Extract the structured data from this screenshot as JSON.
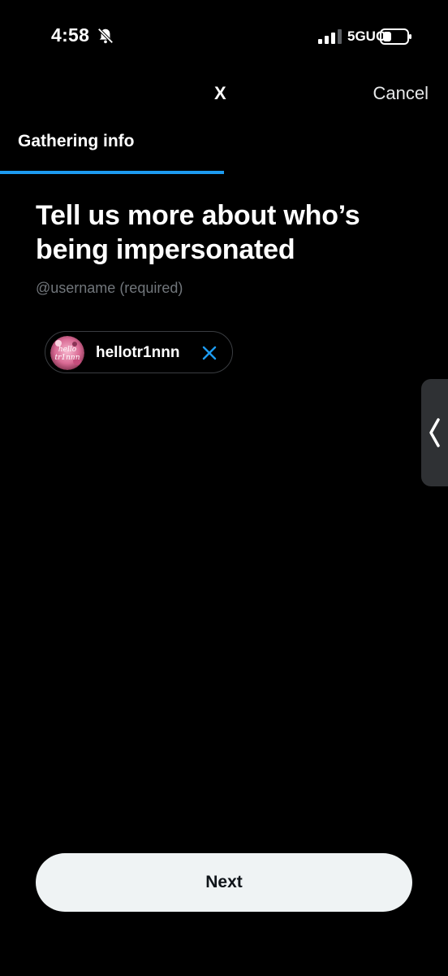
{
  "status_bar": {
    "time": "4:58",
    "network": "5GUC"
  },
  "header": {
    "logo": "X",
    "cancel_label": "Cancel"
  },
  "step": {
    "label": "Gathering info",
    "progress": 0.5
  },
  "content": {
    "heading": "Tell us more about who’s being impersonated",
    "field_label": "@username (required)",
    "selected_user": {
      "username": "hellotr1nnn",
      "avatar_text": "hello tr1nnn"
    }
  },
  "footer": {
    "next_label": "Next"
  },
  "colors": {
    "accent": "#1d9bf0",
    "background": "#000000",
    "button_bg": "#eff3f4",
    "muted_text": "#71767b"
  },
  "icons": {
    "bell": "bell-slash-icon",
    "signal": "signal-icon",
    "battery": "battery-icon",
    "remove": "close-icon",
    "handle": "chevron-left-icon"
  }
}
